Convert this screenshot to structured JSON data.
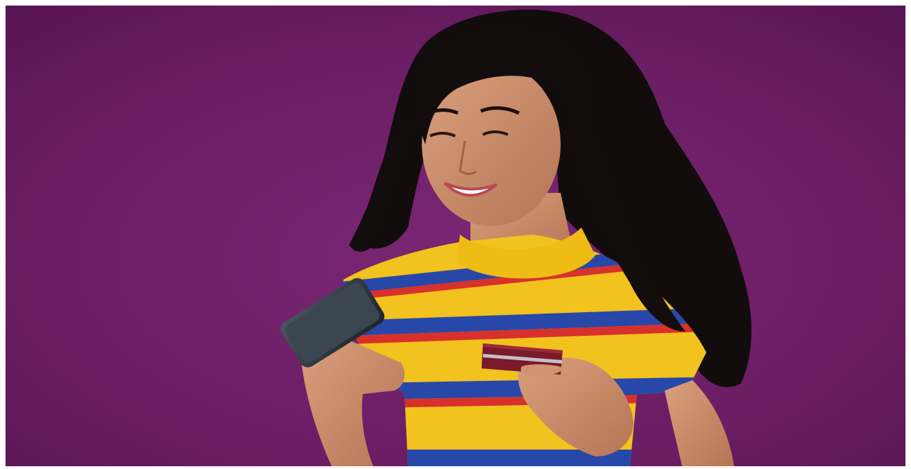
{
  "image": {
    "kind": "photograph",
    "background_color": "#6e1f66",
    "background_light": "#7a2674",
    "background_dark": "#561550",
    "shirt_yellow": "#f2c21e",
    "shirt_blue": "#2748a8",
    "shirt_red": "#d8312c",
    "skin_tone": "#c98a66",
    "hair_color": "#120c0d",
    "phone_color": "#2a3138",
    "card_color": "#7a1a2a",
    "frame_color": "#ffffff"
  }
}
